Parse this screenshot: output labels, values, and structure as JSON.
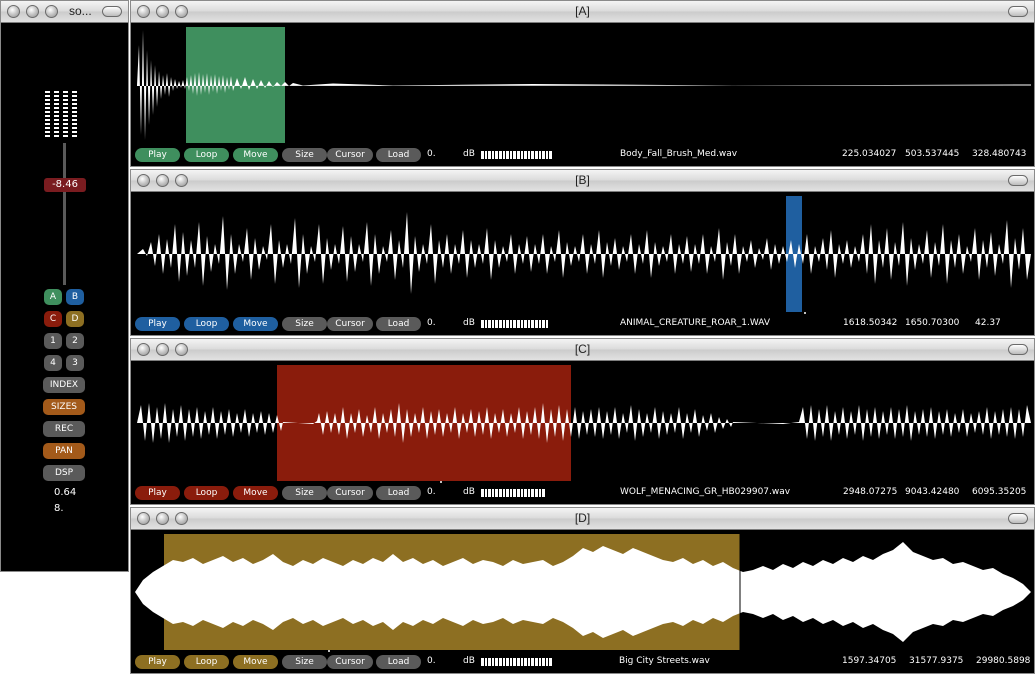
{
  "mixer": {
    "title": "so...",
    "gain_value": "-8.46",
    "buttons": [
      {
        "label": "A",
        "color": "#3f8f5e"
      },
      {
        "label": "B",
        "color": "#1f5fa0"
      },
      {
        "label": "C",
        "color": "#8a1c0c"
      },
      {
        "label": "D",
        "color": "#8d6f22"
      },
      {
        "label": "1",
        "color": "#5a5a5a"
      },
      {
        "label": "2",
        "color": "#5a5a5a"
      },
      {
        "label": "4",
        "color": "#5a5a5a"
      },
      {
        "label": "3",
        "color": "#5a5a5a"
      }
    ],
    "wide_buttons": [
      {
        "label": "INDEX",
        "color": "#5a5a5a"
      },
      {
        "label": "SIZES",
        "color": "#a35a1a"
      },
      {
        "label": "REC",
        "color": "#5a5a5a"
      },
      {
        "label": "PAN",
        "color": "#a35a1a"
      },
      {
        "label": "DSP",
        "color": "#5a5a5a"
      }
    ],
    "value_1": "0.64",
    "value_2": "8."
  },
  "players": [
    {
      "title": "[A]",
      "accent": "#3f8f5e",
      "labels": {
        "play": "Play",
        "loop": "Loop",
        "move": "Move",
        "size": "Size",
        "cursor": "Cursor",
        "load": "Load"
      },
      "zero": "0.",
      "db": "dB",
      "meter_segments": 20,
      "filename": "Body_Fall_Brush_Med.wav",
      "val1": "225.034027",
      "val2": "503.537445",
      "val3": "328.480743"
    },
    {
      "title": "[B]",
      "accent": "#1f5fa0",
      "labels": {
        "play": "Play",
        "loop": "Loop",
        "move": "Move",
        "size": "Size",
        "cursor": "Cursor",
        "load": "Load"
      },
      "zero": "0.",
      "db": "dB",
      "meter_segments": 19,
      "filename": "ANIMAL_CREATURE_ROAR_1.WAV",
      "val1": "1618.50342",
      "val2": "1650.70300",
      "val3": "42.37"
    },
    {
      "title": "[C]",
      "accent": "#8a1c0c",
      "labels": {
        "play": "Play",
        "loop": "Loop",
        "move": "Move",
        "size": "Size",
        "cursor": "Cursor",
        "load": "Load"
      },
      "zero": "0.",
      "db": "dB",
      "meter_segments": 18,
      "filename": "WOLF_MENACING_GR_HB029907.wav",
      "val1": "2948.07275",
      "val2": "9043.42480",
      "val3": "6095.35205"
    },
    {
      "title": "[D]",
      "accent": "#8d6f22",
      "labels": {
        "play": "Play",
        "loop": "Loop",
        "move": "Move",
        "size": "Size",
        "cursor": "Cursor",
        "load": "Load"
      },
      "zero": "0.",
      "db": "dB",
      "meter_segments": 20,
      "filename": "Big City Streets.wav",
      "val1": "1597.34705",
      "val2": "31577.9375",
      "val3": "29980.5898"
    }
  ]
}
